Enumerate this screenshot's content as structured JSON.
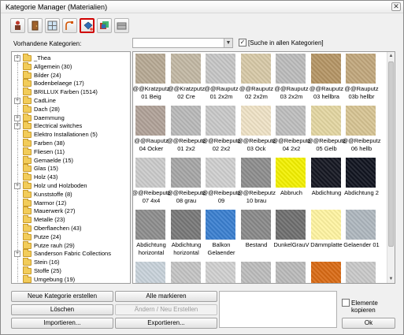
{
  "window": {
    "title": "Kategorie Manager (Materialien)",
    "close_glyph": "✕"
  },
  "toolbar": {
    "buttons": [
      {
        "icon": "person-icon"
      },
      {
        "icon": "door-icon"
      },
      {
        "icon": "window-icon"
      },
      {
        "icon": "faucet-icon"
      },
      {
        "icon": "paint-bucket-icon",
        "active": true
      },
      {
        "icon": "texture-icon"
      },
      {
        "icon": "box-icon"
      }
    ]
  },
  "categories_label": "Vorhandene Kategorien:",
  "search": {
    "value": "",
    "dropdown_glyph": "▼"
  },
  "search_all": {
    "checked": true,
    "label": "[Suche in allen Kategorien]",
    "check_glyph": "✓"
  },
  "tree": [
    {
      "label": "_Thea",
      "expander": "+"
    },
    {
      "label": "Allgemein (30)"
    },
    {
      "label": "Bilder (24)"
    },
    {
      "label": "Bodenbelaege (17)"
    },
    {
      "label": "BRILLUX Farben (1514)"
    },
    {
      "label": "CadLine",
      "expander": "+"
    },
    {
      "label": "Dach (28)"
    },
    {
      "label": "Daemmung",
      "expander": "+"
    },
    {
      "label": "Electrical switches",
      "expander": "+"
    },
    {
      "label": "Elektro Installationen (5)"
    },
    {
      "label": "Farben (38)"
    },
    {
      "label": "Fliesen (11)"
    },
    {
      "label": "Gemaelde (15)"
    },
    {
      "label": "Glas (15)"
    },
    {
      "label": "Holz (43)"
    },
    {
      "label": "Holz und Holzboden",
      "expander": "+"
    },
    {
      "label": "Kunststoffe (8)"
    },
    {
      "label": "Marmor (12)"
    },
    {
      "label": "Mauerwerk (27)"
    },
    {
      "label": "Metalle (23)"
    },
    {
      "label": "Oberflaechen (43)"
    },
    {
      "label": "Putze (24)"
    },
    {
      "label": "Putze rauh (29)"
    },
    {
      "label": "Sanderson Fabric Collections",
      "expander": "+"
    },
    {
      "label": "Stein (16)"
    },
    {
      "label": "Stoffe (25)"
    },
    {
      "label": "Umgebung (19)"
    }
  ],
  "materials": [
    {
      "label": "@@Kratzputz 01 Beig",
      "color": "#b7a994"
    },
    {
      "label": "@@Kratzputz 02 Cre",
      "color": "#c2b8a4"
    },
    {
      "label": "@@Rauputz 01 2x2m",
      "color": "#c6c6c6"
    },
    {
      "label": "@@Rauputz 02 2x2m",
      "color": "#d7c9a7"
    },
    {
      "label": "@@Rauputz 03 2x2m",
      "color": "#bcbcbc"
    },
    {
      "label": "@@Rauputz 03 hellbra",
      "color": "#b59565"
    },
    {
      "label": "@@Rauputz 03b hellbr",
      "color": "#c1a77c"
    },
    {
      "label": "@@Rauputz 04 Ocker",
      "color": "#b0a298"
    },
    {
      "label": "@@Reibeputz 01 2x2",
      "color": "#b9b9b9"
    },
    {
      "label": "@@Reibeputz 02 2x2",
      "color": "#c9c9c9"
    },
    {
      "label": "@@Reibeputz 03 Ock",
      "color": "#efe2c6"
    },
    {
      "label": "@@Reibeputz 04 2x2",
      "color": "#bebebe"
    },
    {
      "label": "@@Reibeputz 05 Gelb",
      "color": "#e3d6a2"
    },
    {
      "label": "@@Reibeputz 06 hellb",
      "color": "#d7c493"
    },
    {
      "label": "@@Reibeputz 07 4x4",
      "color": "#cbcbcb"
    },
    {
      "label": "@@Reibeputz 08 grau",
      "color": "#a6a6a6"
    },
    {
      "label": "@@Reibeputz 09",
      "color": "#cfcfcf"
    },
    {
      "label": "@@Reibeputz 10 brau",
      "color": "#8d8d8d"
    },
    {
      "label": "Abbruch",
      "color": "#f3f000"
    },
    {
      "label": "Abdichtung",
      "color": "#151722"
    },
    {
      "label": "Abdichtung 2",
      "color": "#111420"
    },
    {
      "label": "Abdichtung horizontal",
      "color": "#8d8d8d"
    },
    {
      "label": "Abdichtung horizontal",
      "color": "#787878"
    },
    {
      "label": "Balkon Gelaender",
      "color": "#3a7fd0"
    },
    {
      "label": "Bestand",
      "color": "#898989"
    },
    {
      "label": "DunkelGrauV",
      "color": "#6f6f6f"
    },
    {
      "label": "Dämmplatte",
      "color": "#fff4a2"
    },
    {
      "label": "Gelaender 01",
      "color": "#aeb7be"
    },
    {
      "label": "",
      "color": "#c8d2da"
    },
    {
      "label": "",
      "color": "#c4c4c4"
    },
    {
      "label": "",
      "color": "#d0d0d0"
    },
    {
      "label": "",
      "color": "#bcbcbc"
    },
    {
      "label": "",
      "color": "#bababa"
    },
    {
      "label": "",
      "color": "#d96a14"
    },
    {
      "label": "",
      "color": "#c9c9c9"
    }
  ],
  "buttons": {
    "new_category": "Neue Kategorie erstellen",
    "mark_all": "Alle markieren",
    "delete": "Löschen",
    "change_new": "Ändern / Neu Erstellen",
    "import": "Importieren...",
    "export": "Exportieren...",
    "ok": "Ok"
  },
  "copy_elements": {
    "checked": false,
    "label": "Elemente kopieren"
  }
}
